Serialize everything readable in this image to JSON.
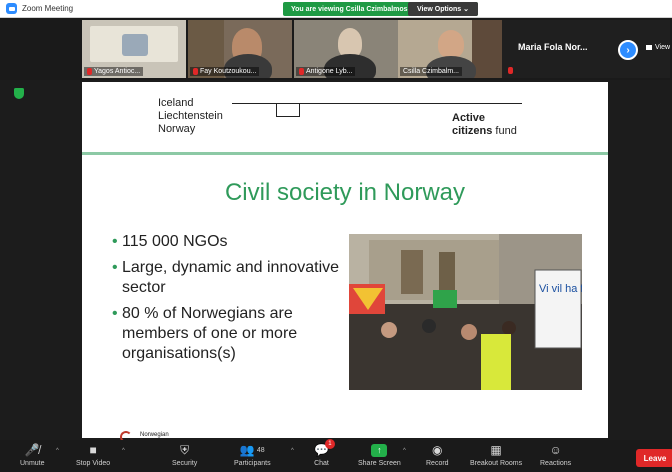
{
  "window": {
    "title": "Zoom Meeting"
  },
  "banner": {
    "viewing_text": "You are viewing Csilla Czimbalmos NHC's screen",
    "view_options": "View Options ⌄"
  },
  "participants_strip": {
    "tiles": [
      {
        "name": "Yagos Antioc..."
      },
      {
        "name": "Fay Koutzoukou..."
      },
      {
        "name": "Antigone Lyb..."
      },
      {
        "name": "Csilla Czimbalm..."
      }
    ],
    "named_tile": {
      "name": "Maria Fola Nor..."
    },
    "view_label": "View"
  },
  "slide": {
    "logo_lines": [
      "Iceland",
      "Liechtenstein",
      "Norway"
    ],
    "fund_line1": "Active",
    "fund_line2_bold": "citizens",
    "fund_line2_rest": " fund",
    "title": "Civil society in Norway",
    "bullets": [
      "115 000 NGOs",
      "Large, dynamic and innovative sector",
      "80 % of Norwegians are members of one or more organisations(s)"
    ],
    "photo_sign_text": "Vi vil ha flere med",
    "footer_text": "Norwegian"
  },
  "toolbar": {
    "unmute": "Unmute",
    "stop_video": "Stop Video",
    "security": "Security",
    "participants": "Participants",
    "participants_count": "48",
    "chat": "Chat",
    "chat_badge": "1",
    "share_screen": "Share Screen",
    "record": "Record",
    "breakout_rooms": "Breakout Rooms",
    "reactions": "Reactions",
    "leave": "Leave"
  },
  "colors": {
    "accent_blue": "#2d8cff",
    "share_green": "#23b04a",
    "leave_red": "#e02828",
    "slide_green": "#2f9a5a"
  }
}
